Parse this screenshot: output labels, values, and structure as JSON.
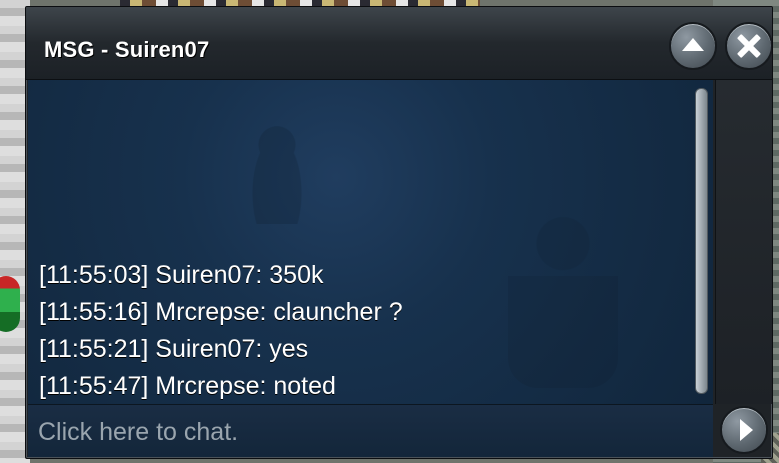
{
  "window": {
    "title": "MSG - Suiren07"
  },
  "messages": [
    {
      "text": "[11:55:03] Suiren07: 350k"
    },
    {
      "text": "[11:55:16] Mrcrepse: clauncher ?"
    },
    {
      "text": "[11:55:21] Suiren07: yes"
    },
    {
      "text": "[11:55:47] Mrcrepse: noted"
    }
  ],
  "input": {
    "placeholder": "Click here to chat."
  },
  "icons": {
    "minimize": "up-arrow-icon",
    "close": "close-icon",
    "send": "right-arrow-icon"
  },
  "colors": {
    "chat_background": "#17314d",
    "title_bar": "#23282d",
    "text": "#ffffff",
    "placeholder": "#9aa5ae"
  }
}
